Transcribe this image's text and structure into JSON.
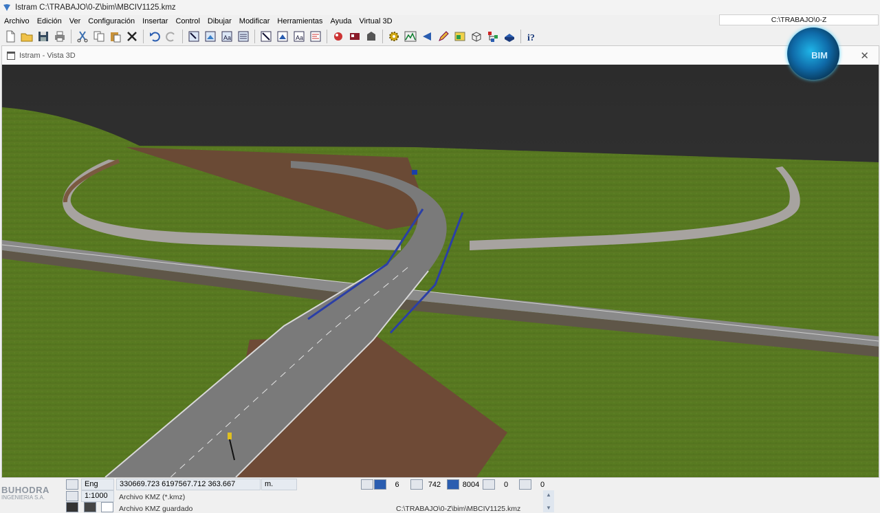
{
  "app": {
    "title": "Istram  C:\\TRABAJO\\0-Z\\bim\\MBCIV1125.kmz",
    "path_box": "C:\\TRABAJO\\0-Z"
  },
  "menu": [
    "Archivo",
    "Edición",
    "Ver",
    "Configuración",
    "Insertar",
    "Control",
    "Dibujar",
    "Modificar",
    "Herramientas",
    "Ayuda",
    "Virtual 3D"
  ],
  "toolbar_icons": [
    "new-file-icon",
    "open-folder-icon",
    "save-icon",
    "print-icon",
    "cut-icon",
    "copy-icon",
    "paste-icon",
    "delete-icon",
    "undo-icon",
    "redo-icon",
    "zoom-window-icon",
    "zoom-extents-icon",
    "text-style-icon",
    "layers-icon",
    "view-top-icon",
    "view-front-icon",
    "text-icon",
    "properties-icon",
    "render-icon",
    "materials-icon",
    "export-icon",
    "gear-icon",
    "profile-icon",
    "arrow-icon",
    "pencil-icon",
    "image-icon",
    "box-3d-icon",
    "tree-icon",
    "globe-icon",
    "help-icon"
  ],
  "logo": {
    "text": "BIM"
  },
  "viewer": {
    "title": "Istram - Vista 3D",
    "close": "✕"
  },
  "status": {
    "mode": "Eng Libre",
    "scale": "1:1000",
    "coords": "330669.723  6197567.712   363.667",
    "units": "m.",
    "counters": [
      "6",
      "742",
      "8004",
      "0",
      "0"
    ],
    "messages": [
      "Archivo KMZ (*.kmz)",
      "Archivo KMZ guardado"
    ],
    "saved_path": "C:\\TRABAJO\\0-Z\\bim\\MBCIV1125.kmz"
  },
  "brand": {
    "name": "BUHODRA",
    "sub": "INGENIERIA S.A."
  },
  "colors": {
    "sky": "#333333",
    "grass": "#5a7a22",
    "road": "#7d7d7d",
    "railing": "#2b3fa6"
  }
}
